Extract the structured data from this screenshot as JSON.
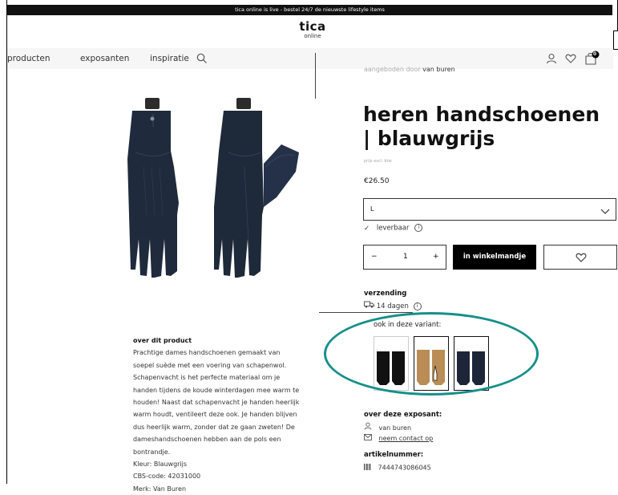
{
  "topbar": {
    "text": "tica online is live - bestel 24/7 de nieuwste lifestyle items"
  },
  "logo": {
    "main": "tica",
    "sub": "online"
  },
  "nav": {
    "items": [
      "producten",
      "exposanten",
      "inspiratie"
    ],
    "cart_count": "0",
    "icons": [
      "search-icon",
      "user-icon",
      "heart-icon",
      "cart-icon"
    ]
  },
  "product": {
    "vendor_prefix": "aangeboden door",
    "vendor_name": "van buren",
    "title": "heren handschoenen | blauwgrijs",
    "tag": "prijs excl. btw",
    "price": "€26.50",
    "size": "L",
    "stock": "leverbaar",
    "quantity": "1",
    "qty_minus": "−",
    "qty_plus": "+",
    "add_to_cart": "in winkelmandje"
  },
  "shipping": {
    "title": "verzending",
    "days": "14 dagen"
  },
  "variants": {
    "title": "ook in deze variant:",
    "items": [
      {
        "name": "black",
        "color": "#111111"
      },
      {
        "name": "camel",
        "color": "#b98d55"
      },
      {
        "name": "navy",
        "color": "#1d2638"
      }
    ]
  },
  "exposant": {
    "title": "over deze exposant:",
    "name": "van buren",
    "contact": "neem contact op"
  },
  "article": {
    "title": "artikelnummer:",
    "number": "7444743086045"
  },
  "description": {
    "heading": "over dit product",
    "lines": [
      "Prachtige dames handschoenen gemaakt van",
      "soepel suède met een voering van schapenwol.",
      "Schapenvacht is het perfecte materiaal om je",
      "handen tijdens de koude winterdagen mee warm te",
      "houden! Naast dat schapenvacht je handen heerlijk",
      "warm houdt, ventileert deze ook. Je handen blijven",
      "dus heerlijk warm, zonder dat ze gaan zweten! De",
      "dameshandschoenen hebben aan de pols een",
      "bontrandje.",
      "Kleur: Blauwgrijs",
      "CBS-code: 42031000",
      "Merk: Van Buren"
    ]
  },
  "colors": {
    "accent": "#178f8a",
    "topbar": "#111111",
    "nav_bg": "#f6f6f6"
  }
}
